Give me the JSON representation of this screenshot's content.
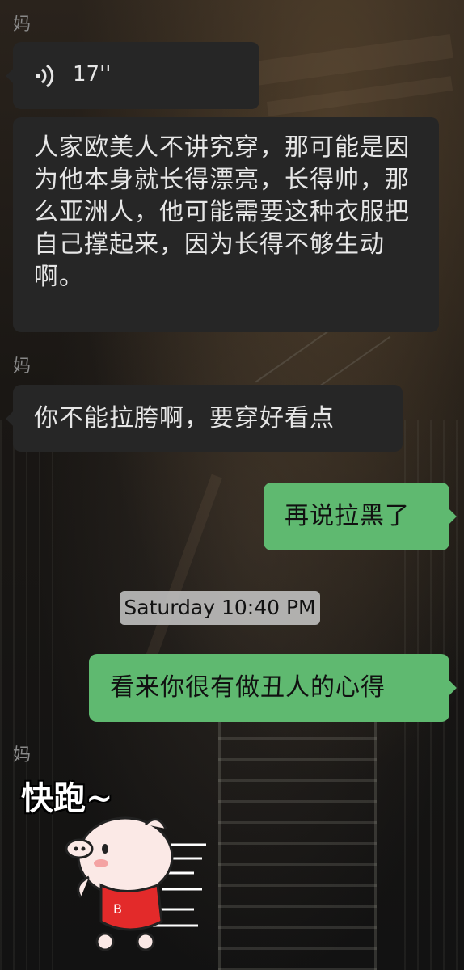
{
  "messages": [
    {
      "sender": "妈"
    },
    {
      "type": "voice",
      "duration": "17''"
    },
    {
      "text": "人家欧美人不讲究穿，那可能是因为他本身就长得漂亮，长得帅，那么亚洲人，他可能需要这种衣服把自己撑起来，因为长得不够生动啊。"
    },
    {
      "sender": "妈",
      "text": "你不能拉胯啊，要穿好看点"
    },
    {
      "text": "再说拉黑了"
    },
    {
      "timestamp": "Saturday 10:40 PM"
    },
    {
      "text": "看来你很有做丑人的心得"
    },
    {
      "sender": "妈",
      "sticker_text": "快跑~"
    }
  ],
  "colors": {
    "left_bubble": "#262626",
    "right_bubble": "#5fb970",
    "sender_name": "#8a8a8a"
  },
  "icons": [
    "voice-wave-icon",
    "running-pig-sticker"
  ]
}
